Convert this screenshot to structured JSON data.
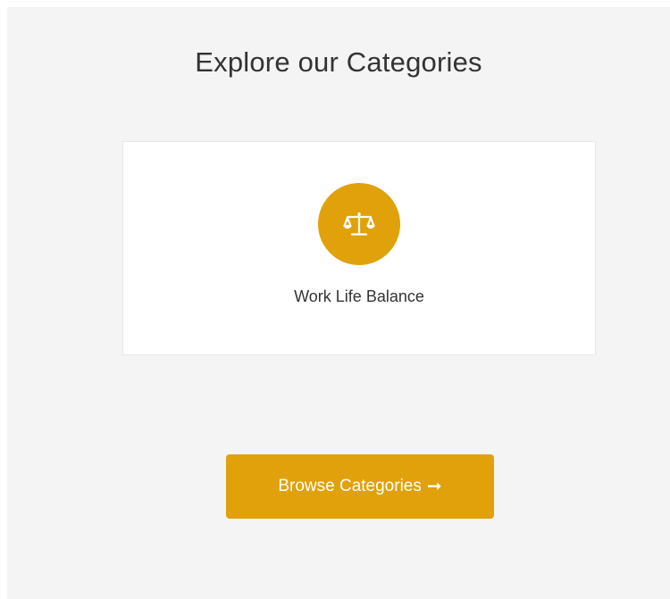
{
  "section": {
    "title": "Explore our Categories"
  },
  "categories": [
    {
      "label": "Work Life Balance",
      "icon": "balance-scale-icon",
      "color": "#e0a10a"
    }
  ],
  "browse_button": {
    "label": "Browse Categories",
    "icon": "arrow-right-icon",
    "arrow_glyph": "➞",
    "color": "#e0a10a"
  },
  "colors": {
    "background": "#f4f4f4",
    "card": "#ffffff",
    "accent": "#e0a10a",
    "text": "#333333"
  }
}
